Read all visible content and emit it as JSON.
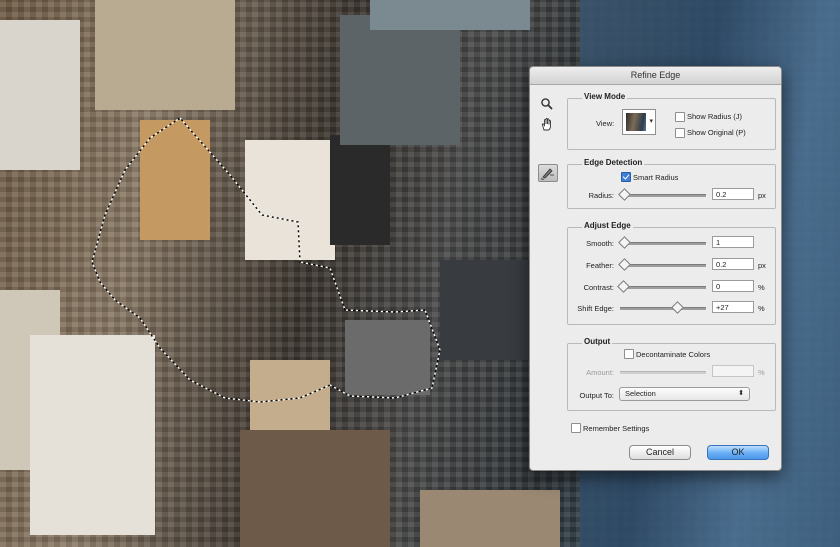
{
  "dialog": {
    "title": "Refine Edge",
    "tools": [
      "zoom-icon",
      "hand-icon",
      "refine-radius-brush-icon"
    ]
  },
  "view_mode": {
    "title": "View Mode",
    "view_label": "View:",
    "show_radius": {
      "label": "Show Radius (J)",
      "checked": false
    },
    "show_original": {
      "label": "Show Original (P)",
      "checked": false
    }
  },
  "edge_detection": {
    "title": "Edge Detection",
    "smart_radius": {
      "label": "Smart Radius",
      "checked": true
    },
    "radius": {
      "label": "Radius:",
      "value": "0.2",
      "unit": "px",
      "slider": 0.01
    }
  },
  "adjust_edge": {
    "title": "Adjust Edge",
    "smooth": {
      "label": "Smooth:",
      "value": "1",
      "unit": "",
      "slider": 0.01
    },
    "feather": {
      "label": "Feather:",
      "value": "0.2",
      "unit": "px",
      "slider": 0.01
    },
    "contrast": {
      "label": "Contrast:",
      "value": "0",
      "unit": "%",
      "slider": 0.0
    },
    "shift_edge": {
      "label": "Shift Edge:",
      "value": "+27",
      "unit": "%",
      "slider": 0.635
    }
  },
  "output": {
    "title": "Output",
    "decontaminate": {
      "label": "Decontaminate Colors",
      "checked": false
    },
    "amount": {
      "label": "Amount:",
      "value": "",
      "unit": "%"
    },
    "output_to": {
      "label": "Output To:",
      "value": "Selection"
    }
  },
  "remember_settings": {
    "label": "Remember Settings",
    "checked": false
  },
  "buttons": {
    "cancel": "Cancel",
    "ok": "OK"
  },
  "colors": {
    "ok_button": "#5aa2ef",
    "checkbox_checked": "#3d7fd6",
    "dialog_bg": "#ececec"
  }
}
